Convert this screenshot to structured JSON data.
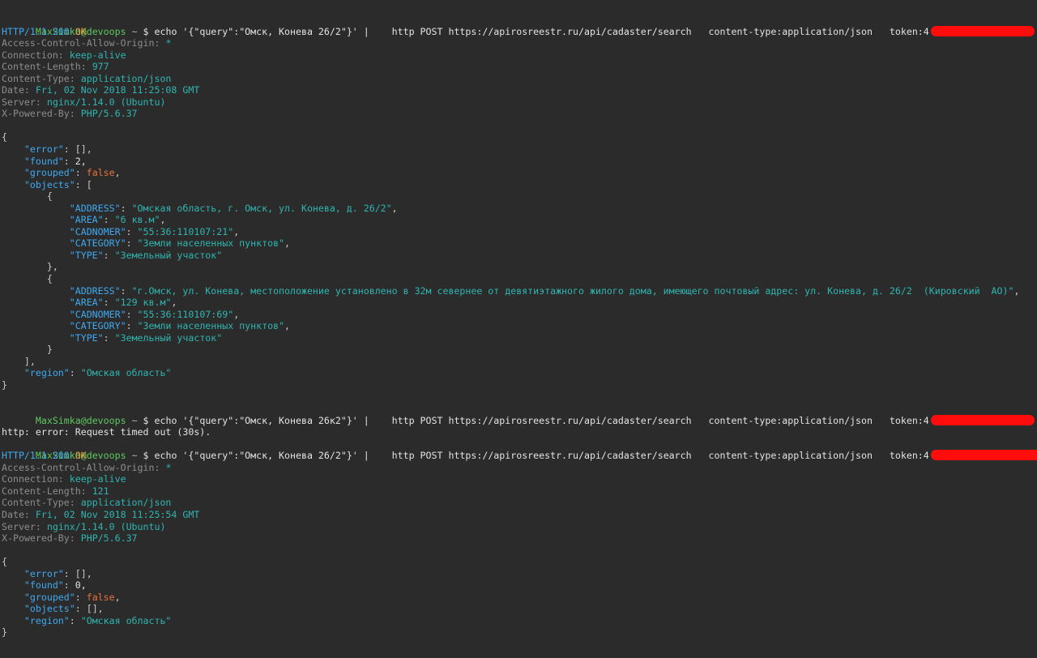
{
  "colors": {
    "background": "#2b2b2b",
    "prompt_user": "#5fc95f",
    "json_key": "#3fa9f0",
    "json_string": "#2fb5b0",
    "status_ok": "#e8a33c",
    "json_bool": "#e8713a",
    "redaction": "#ff0d0d"
  },
  "prompt": {
    "user": "MaxSimka@devoops",
    "dir": "~",
    "symbol": "$"
  },
  "commands": {
    "cmd1": "echo '{\"query\":\"Омск, Конева 26/2\"}' |    http POST https://apirosreestr.ru/api/cadaster/search   content-type:application/json   token:",
    "cmd1_token_visible": "4",
    "cmd2": "echo '{\"query\":\"Омск, Конева 26к2\"}' |    http POST https://apirosreestr.ru/api/cadaster/search   content-type:application/json   token:",
    "cmd2_token_visible": "4",
    "cmd3": "echo '{\"query\":\"Омск, Конева 26/2\"}' |    http POST https://apirosreestr.ru/api/cadaster/search   content-type:application/json   token:",
    "cmd3_token_visible": "4",
    "error_line": "http: error: Request timed out (30s)."
  },
  "response1": {
    "status_proto": "HTTP/1.1 200",
    "status_text": "OK",
    "headers": [
      {
        "name": "Access-Control-Allow-Origin:",
        "value": "*"
      },
      {
        "name": "Connection:",
        "value": "keep-alive"
      },
      {
        "name": "Content-Length:",
        "value": "977"
      },
      {
        "name": "Content-Type:",
        "value": "application/json"
      },
      {
        "name": "Date:",
        "value": "Fri, 02 Nov 2018 11:25:08 GMT"
      },
      {
        "name": "Server:",
        "value": "nginx/1.14.0 (Ubuntu)"
      },
      {
        "name": "X-Powered-By:",
        "value": "PHP/5.6.37"
      }
    ],
    "body": {
      "error_key": "\"error\"",
      "error_val": "[],",
      "found_key": "\"found\"",
      "found_val": "2,",
      "grouped_key": "\"grouped\"",
      "grouped_val": "false",
      "objects_key": "\"objects\"",
      "objects": [
        {
          "address_key": "\"ADDRESS\"",
          "address": "\"Омская область, г. Омск, ул. Конева, д. 26/2\"",
          "area_key": "\"AREA\"",
          "area": "\"6 кв.м\"",
          "cadnomer_key": "\"CADNOMER\"",
          "cadnomer": "\"55:36:110107:21\"",
          "category_key": "\"CATEGORY\"",
          "category": "\"Земли населенных пунктов\"",
          "type_key": "\"TYPE\"",
          "type": "\"Земельный участок\""
        },
        {
          "address_key": "\"ADDRESS\"",
          "address": "\"г.Омск, ул. Конева, местоположение установлено в 32м севернее от девятиэтажного жилого дома, имеющего почтовый адрес: ул. Конева, д. 26/2  (Кировский  АО)\"",
          "area_key": "\"AREA\"",
          "area": "\"129 кв.м\"",
          "cadnomer_key": "\"CADNOMER\"",
          "cadnomer": "\"55:36:110107:69\"",
          "category_key": "\"CATEGORY\"",
          "category": "\"Земли населенных пунктов\"",
          "type_key": "\"TYPE\"",
          "type": "\"Земельный участок\""
        }
      ],
      "region_key": "\"region\"",
      "region": "\"Омская область\""
    }
  },
  "response2": {
    "status_proto": "HTTP/1.1 200",
    "status_text": "OK",
    "headers": [
      {
        "name": "Access-Control-Allow-Origin:",
        "value": "*"
      },
      {
        "name": "Connection:",
        "value": "keep-alive"
      },
      {
        "name": "Content-Length:",
        "value": "121"
      },
      {
        "name": "Content-Type:",
        "value": "application/json"
      },
      {
        "name": "Date:",
        "value": "Fri, 02 Nov 2018 11:25:54 GMT"
      },
      {
        "name": "Server:",
        "value": "nginx/1.14.0 (Ubuntu)"
      },
      {
        "name": "X-Powered-By:",
        "value": "PHP/5.6.37"
      }
    ],
    "body": {
      "error_key": "\"error\"",
      "error_val": "[],",
      "found_key": "\"found\"",
      "found_val": "0,",
      "grouped_key": "\"grouped\"",
      "grouped_val": "false",
      "objects_key": "\"objects\"",
      "objects_val": "[],",
      "region_key": "\"region\"",
      "region": "\"Омская область\""
    }
  },
  "punct": {
    "open_brace": "{",
    "close_brace": "}",
    "open_brace_comma": "},",
    "open_bracket": "[",
    "close_bracket_comma": "],",
    "colon": ": ",
    "comma": ","
  }
}
